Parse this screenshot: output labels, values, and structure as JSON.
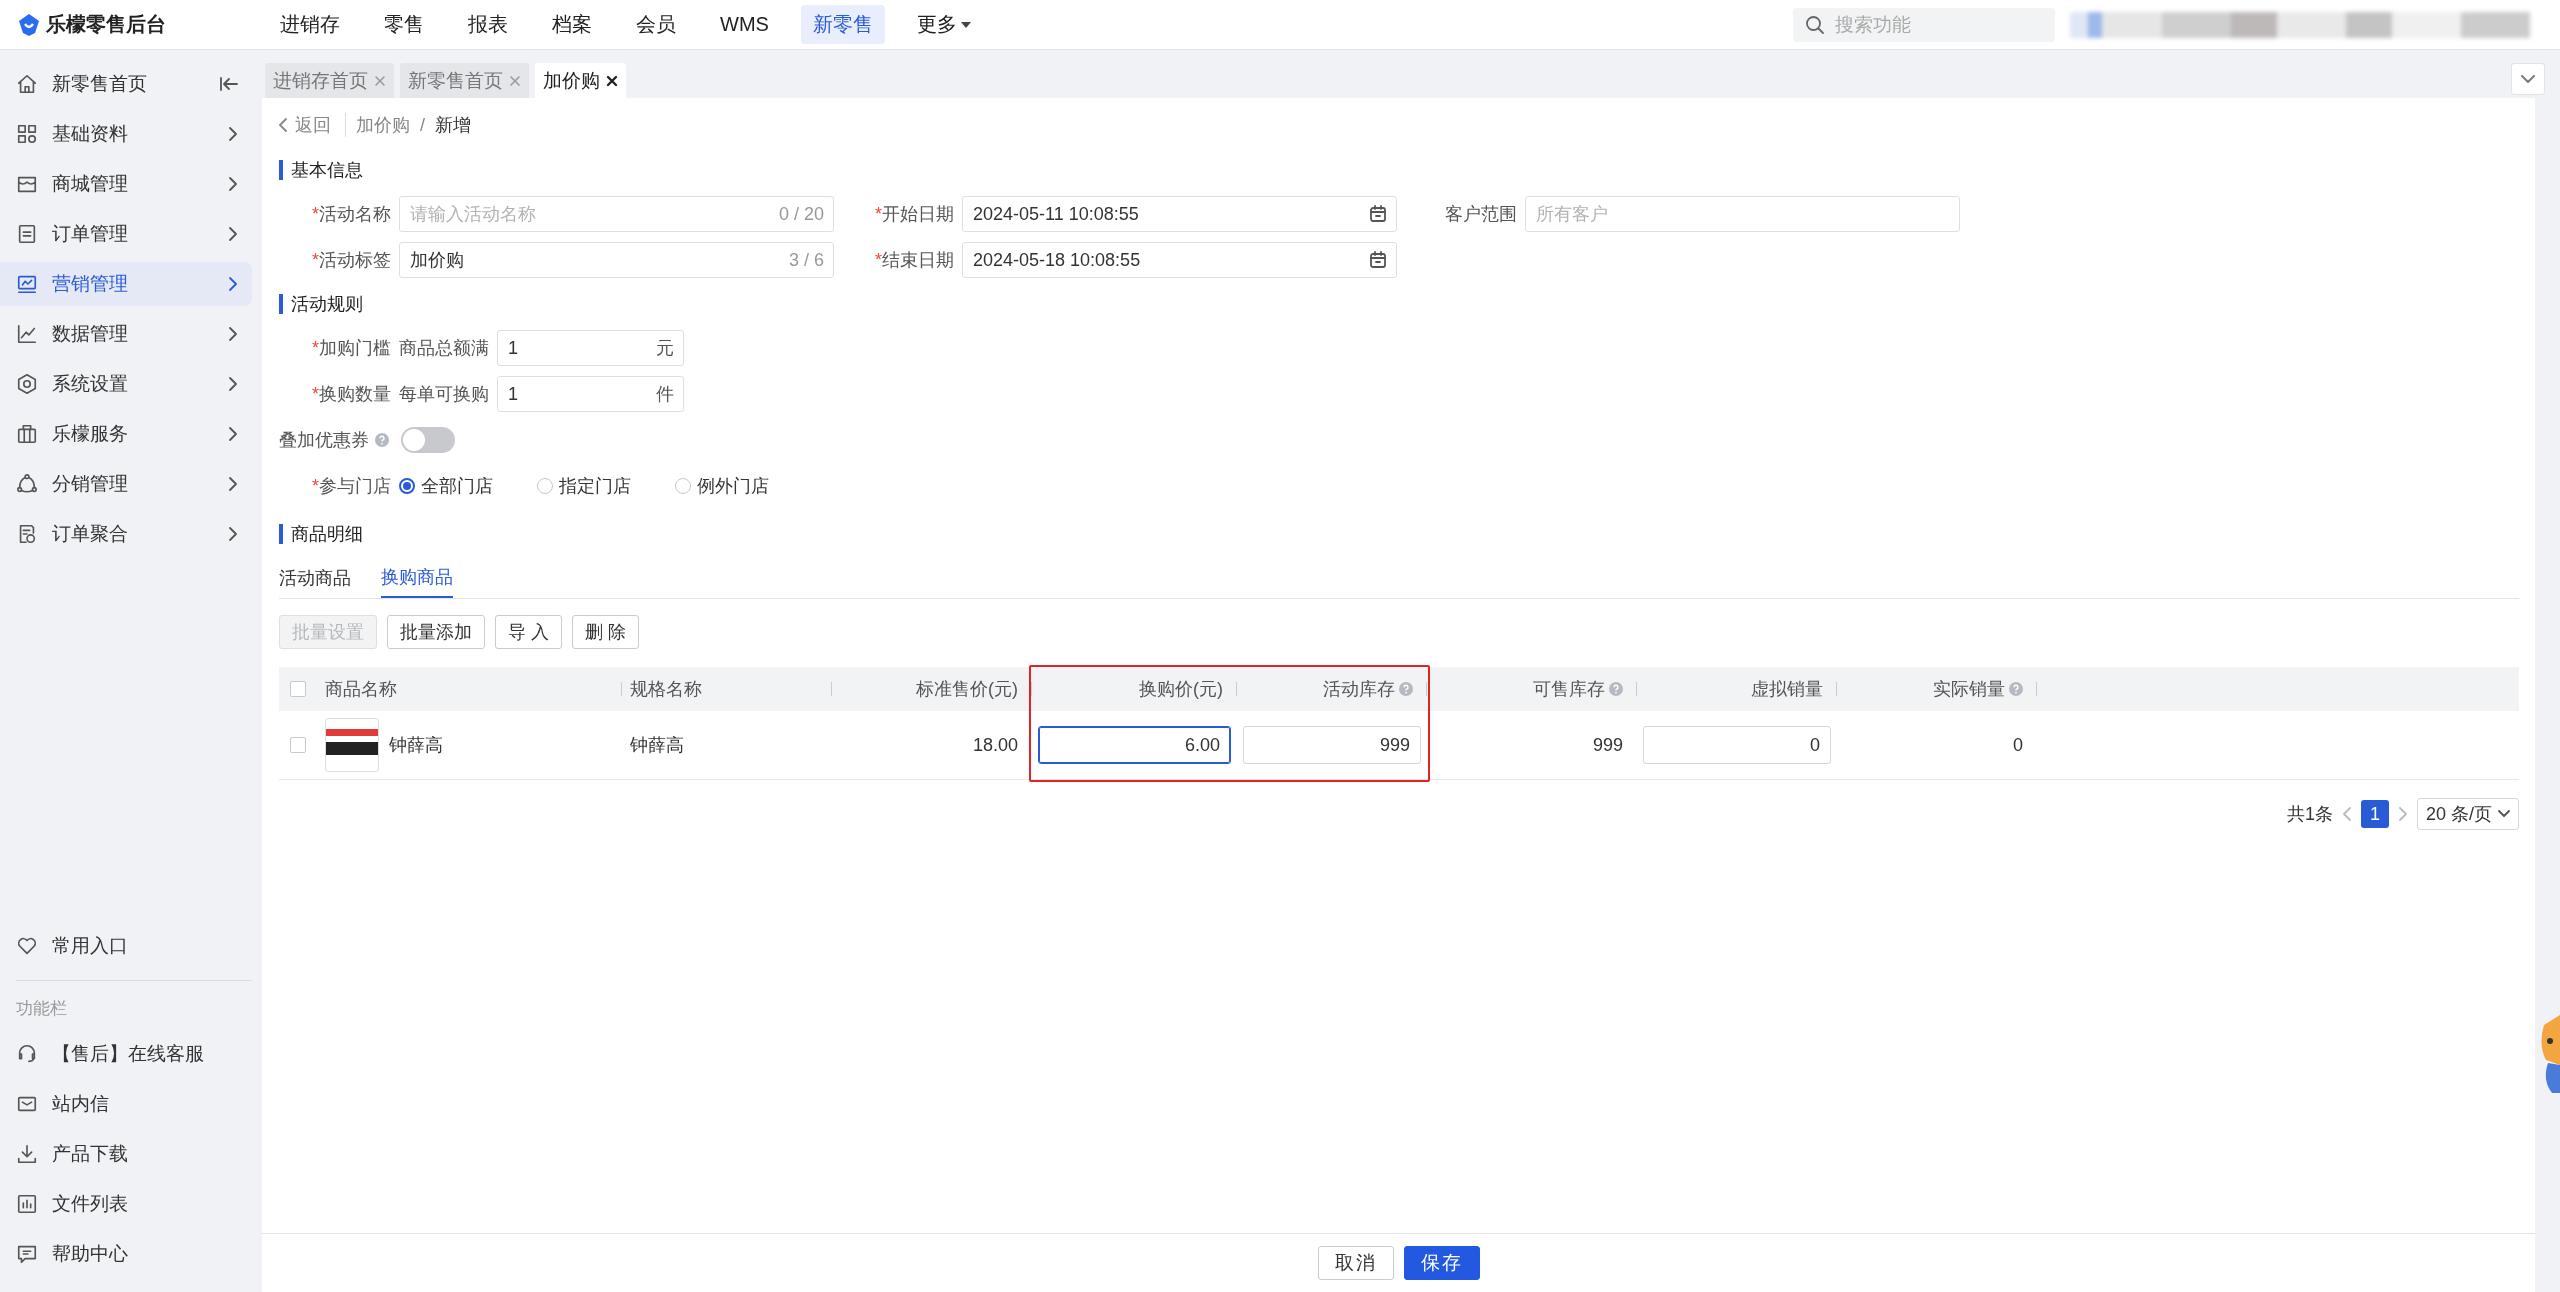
{
  "app": {
    "title": "乐檬零售后台"
  },
  "top_nav": [
    {
      "label": "进销存",
      "selected": false
    },
    {
      "label": "零售",
      "selected": false
    },
    {
      "label": "报表",
      "selected": false
    },
    {
      "label": "档案",
      "selected": false
    },
    {
      "label": "会员",
      "selected": false
    },
    {
      "label": "WMS",
      "selected": false
    },
    {
      "label": "新零售",
      "selected": true
    }
  ],
  "more_menu": {
    "label": "更多"
  },
  "search": {
    "placeholder": "搜索功能"
  },
  "sidebar": {
    "home": {
      "label": "新零售首页"
    },
    "items": [
      {
        "label": "基础资料",
        "selected": false
      },
      {
        "label": "商城管理",
        "selected": false
      },
      {
        "label": "订单管理",
        "selected": false
      },
      {
        "label": "营销管理",
        "selected": true
      },
      {
        "label": "数据管理",
        "selected": false
      },
      {
        "label": "系统设置",
        "selected": false
      },
      {
        "label": "乐檬服务",
        "selected": false
      },
      {
        "label": "分销管理",
        "selected": false
      },
      {
        "label": "订单聚合",
        "selected": false
      }
    ],
    "favorites": {
      "label": "常用入口"
    },
    "section_label": "功能栏",
    "tools": [
      {
        "label": "【售后】在线客服"
      },
      {
        "label": "站内信"
      },
      {
        "label": "产品下载"
      },
      {
        "label": "文件列表"
      },
      {
        "label": "帮助中心"
      }
    ]
  },
  "page_tabs": [
    {
      "label": "进销存首页",
      "selected": false
    },
    {
      "label": "新零售首页",
      "selected": false
    },
    {
      "label": "加价购",
      "selected": true
    }
  ],
  "breadcrumb": {
    "back": "返回",
    "path": [
      "加价购",
      "新增"
    ],
    "separator": "/"
  },
  "basic_info": {
    "title": "基本信息",
    "fields": [
      {
        "label": "活动名称",
        "required_mark": "*",
        "kind": "text",
        "placeholder": "请输入活动名称",
        "counter": "0 / 20"
      },
      {
        "label": "开始日期",
        "required_mark": "*",
        "kind": "date",
        "value": "2024-05-11 10:08:55"
      },
      {
        "label": "客户范围",
        "kind": "text",
        "placeholder": "所有客户"
      },
      {
        "label": "活动标签",
        "required_mark": "*",
        "kind": "text",
        "value": "加价购",
        "counter": "3 / 6"
      },
      {
        "label": "结束日期",
        "required_mark": "*",
        "kind": "date",
        "value": "2024-05-18 10:08:55"
      }
    ]
  },
  "rules": {
    "title": "活动规则",
    "thresholds": [
      {
        "label": "加购门槛",
        "required_mark": "*",
        "prefix": "商品总额满",
        "value": "1",
        "unit": "元"
      },
      {
        "label": "换购数量",
        "required_mark": "*",
        "prefix": "每单可换购",
        "value": "1",
        "unit": "件"
      }
    ],
    "coupon": {
      "label": "叠加优惠券",
      "on": false
    },
    "stores": {
      "label": "参与门店",
      "required_mark": "*",
      "options": [
        {
          "label": "全部门店",
          "selected": true
        },
        {
          "label": "指定门店",
          "selected": false
        },
        {
          "label": "例外门店",
          "selected": false
        }
      ]
    }
  },
  "goods": {
    "title": "商品明细",
    "tabs": [
      {
        "label": "活动商品",
        "selected": false
      },
      {
        "label": "换购商品",
        "selected": true
      }
    ],
    "actions": [
      {
        "label": "批量设置",
        "disabled": true
      },
      {
        "label": "批量添加",
        "disabled": false
      },
      {
        "label": "导 入",
        "disabled": false
      },
      {
        "label": "删 除",
        "disabled": false
      }
    ],
    "table": {
      "select_all": false,
      "columns": [
        {
          "label": "商品名称",
          "numeric": false,
          "help": false,
          "highlighted": false
        },
        {
          "label": "规格名称",
          "numeric": false,
          "help": false,
          "highlighted": false
        },
        {
          "label": "标准售价(元)",
          "numeric": true,
          "help": false,
          "highlighted": false
        },
        {
          "label": "换购价(元)",
          "numeric": true,
          "help": false,
          "highlighted": true
        },
        {
          "label": "活动库存",
          "numeric": true,
          "help": true,
          "highlighted": true
        },
        {
          "label": "可售库存",
          "numeric": true,
          "help": true,
          "highlighted": false
        },
        {
          "label": "虚拟销量",
          "numeric": true,
          "help": false,
          "highlighted": false
        },
        {
          "label": "实际销量",
          "numeric": true,
          "help": true,
          "highlighted": false
        }
      ],
      "rows": [
        {
          "checked": false,
          "cells": [
            {
              "kind": "product",
              "text": "钟薛高"
            },
            {
              "kind": "text",
              "text": "钟薛高"
            },
            {
              "kind": "text",
              "text": "18.00"
            },
            {
              "kind": "input",
              "value": "6.00",
              "focused": true
            },
            {
              "kind": "input",
              "value": "999",
              "focused": false
            },
            {
              "kind": "text",
              "text": "999"
            },
            {
              "kind": "input",
              "value": "0",
              "focused": false
            },
            {
              "kind": "text",
              "text": "0"
            }
          ]
        }
      ]
    },
    "pagination": {
      "total": "共1条",
      "pages": [
        {
          "label": "1",
          "selected": true
        }
      ],
      "page_size": "20 条/页"
    }
  },
  "footer": {
    "buttons": [
      {
        "label": "取消",
        "kind": "secondary"
      },
      {
        "label": "保存",
        "kind": "primary"
      }
    ]
  }
}
